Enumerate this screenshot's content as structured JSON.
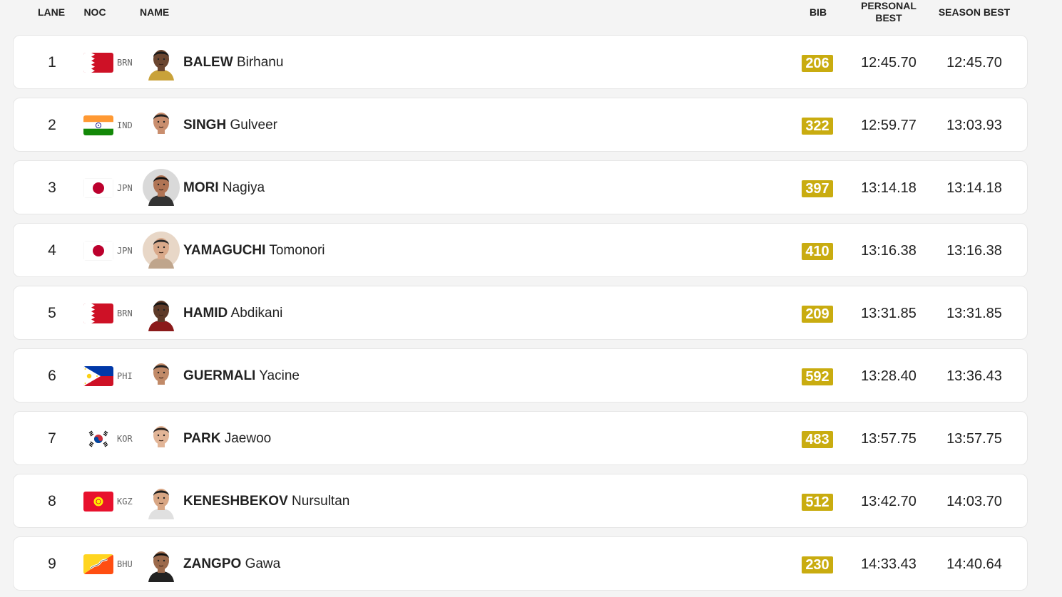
{
  "header": {
    "lane": "LANE",
    "noc": "NOC",
    "name": "NAME",
    "bib": "BIB",
    "personal_best_line1": "PERSONAL",
    "personal_best_line2": "BEST",
    "season_best": "SEASON BEST"
  },
  "colors": {
    "bib_background": "#c9ac10",
    "row_background": "#ffffff",
    "page_background": "#f4f4f4"
  },
  "rows": [
    {
      "lane": "1",
      "flag": "bahrain-flag",
      "noc": "BRN",
      "last": "BALEW",
      "first": "Birhanu",
      "bib": "206",
      "pb": "12:45.70",
      "sb": "12:45.70"
    },
    {
      "lane": "2",
      "flag": "india-flag",
      "noc": "IND",
      "last": "SINGH",
      "first": "Gulveer",
      "bib": "322",
      "pb": "12:59.77",
      "sb": "13:03.93"
    },
    {
      "lane": "3",
      "flag": "japan-flag",
      "noc": "JPN",
      "last": "MORI",
      "first": "Nagiya",
      "bib": "397",
      "pb": "13:14.18",
      "sb": "13:14.18"
    },
    {
      "lane": "4",
      "flag": "japan-flag",
      "noc": "JPN",
      "last": "YAMAGUCHI",
      "first": "Tomonori",
      "bib": "410",
      "pb": "13:16.38",
      "sb": "13:16.38"
    },
    {
      "lane": "5",
      "flag": "bahrain-flag",
      "noc": "BRN",
      "last": "HAMID",
      "first": "Abdikani",
      "bib": "209",
      "pb": "13:31.85",
      "sb": "13:31.85"
    },
    {
      "lane": "6",
      "flag": "philippines-flag",
      "noc": "PHI",
      "last": "GUERMALI",
      "first": "Yacine",
      "bib": "592",
      "pb": "13:28.40",
      "sb": "13:36.43"
    },
    {
      "lane": "7",
      "flag": "korea-flag",
      "noc": "KOR",
      "last": "PARK",
      "first": "Jaewoo",
      "bib": "483",
      "pb": "13:57.75",
      "sb": "13:57.75"
    },
    {
      "lane": "8",
      "flag": "kyrgyzstan-flag",
      "noc": "KGZ",
      "last": "KENESHBEKOV",
      "first": "Nursultan",
      "bib": "512",
      "pb": "13:42.70",
      "sb": "14:03.70"
    },
    {
      "lane": "9",
      "flag": "bhutan-flag",
      "noc": "BHU",
      "last": "ZANGPO",
      "first": "Gawa",
      "bib": "230",
      "pb": "14:33.43",
      "sb": "14:40.64"
    }
  ]
}
